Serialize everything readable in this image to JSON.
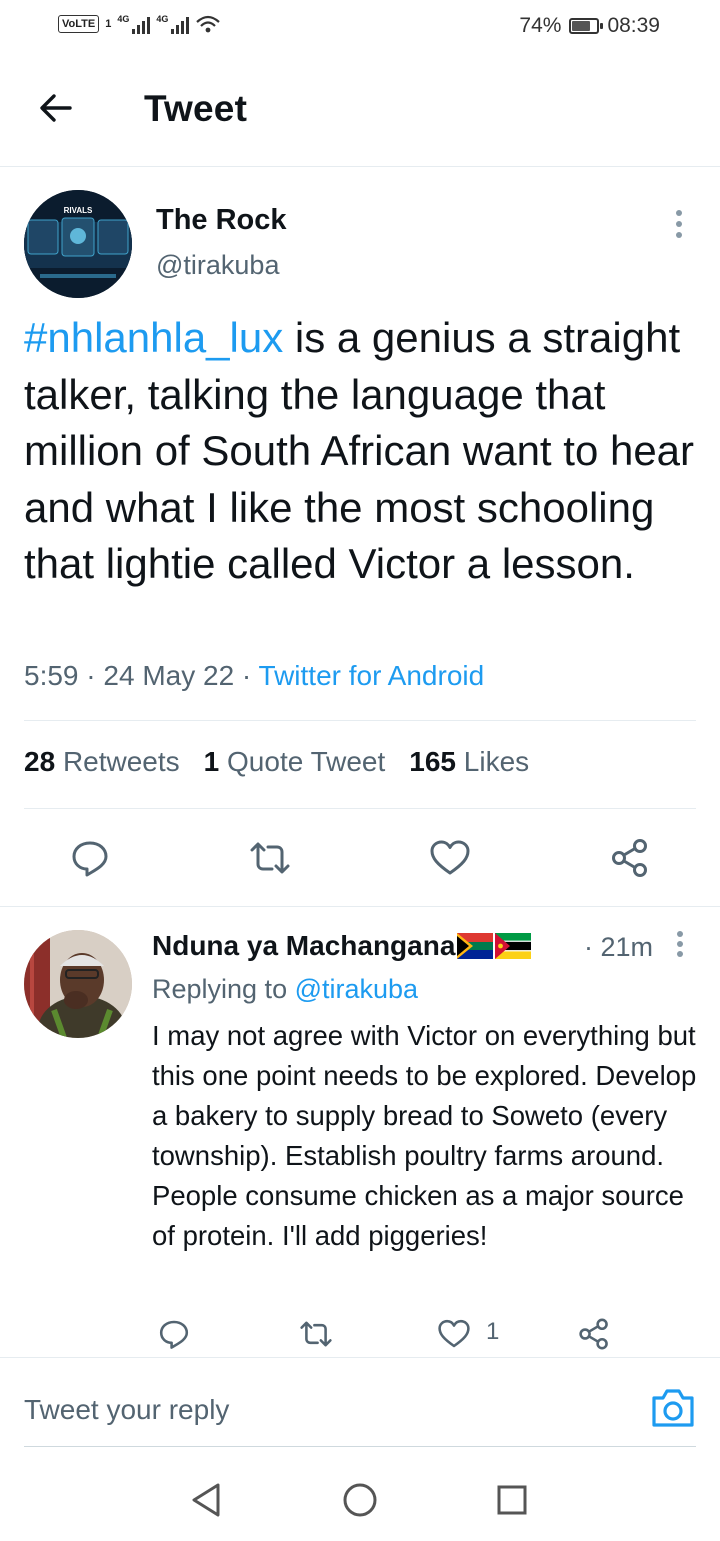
{
  "status_bar": {
    "volte": "VoLTE",
    "sim": "1",
    "network1": "4G",
    "network2": "4G",
    "battery_percent": "74%",
    "battery_level": 0.74,
    "time": "08:39"
  },
  "header": {
    "title": "Tweet",
    "back_icon": "arrow-left-icon"
  },
  "tweet": {
    "author_name": "The Rock",
    "author_handle": "@tirakuba",
    "hashtag": "#nhlanhla_lux",
    "text_rest": " is a genius a straight talker, talking the language that million of South African want to hear and what I like the most schooling that lightie called Victor a lesson.",
    "time": "5:59",
    "date": "24 May 22",
    "separator": " · ",
    "source": "Twitter for Android",
    "retweets_count": "28",
    "retweets_label": "Retweets",
    "quotes_count": "1",
    "quotes_label": "Quote Tweet",
    "likes_count": "165",
    "likes_label": "Likes",
    "avatar_text": "RIVALS"
  },
  "reply": {
    "author_name": "Nduna ya Machangana",
    "time": "· 21m",
    "replying_prefix": "Replying to ",
    "replying_mention": "@tirakuba",
    "text": "I may not agree with Victor on everything but this one point needs to be explored. Develop a bakery to supply bread to Soweto (every township). Establish poultry farms around. People consume chicken as a major source of  protein. I'll add piggeries!",
    "like_count": "1"
  },
  "composer": {
    "placeholder": "Tweet your reply"
  },
  "colors": {
    "accent": "#1d9bf0",
    "text": "#0f1419",
    "secondary": "#536471",
    "divider": "#e6ecf0"
  }
}
